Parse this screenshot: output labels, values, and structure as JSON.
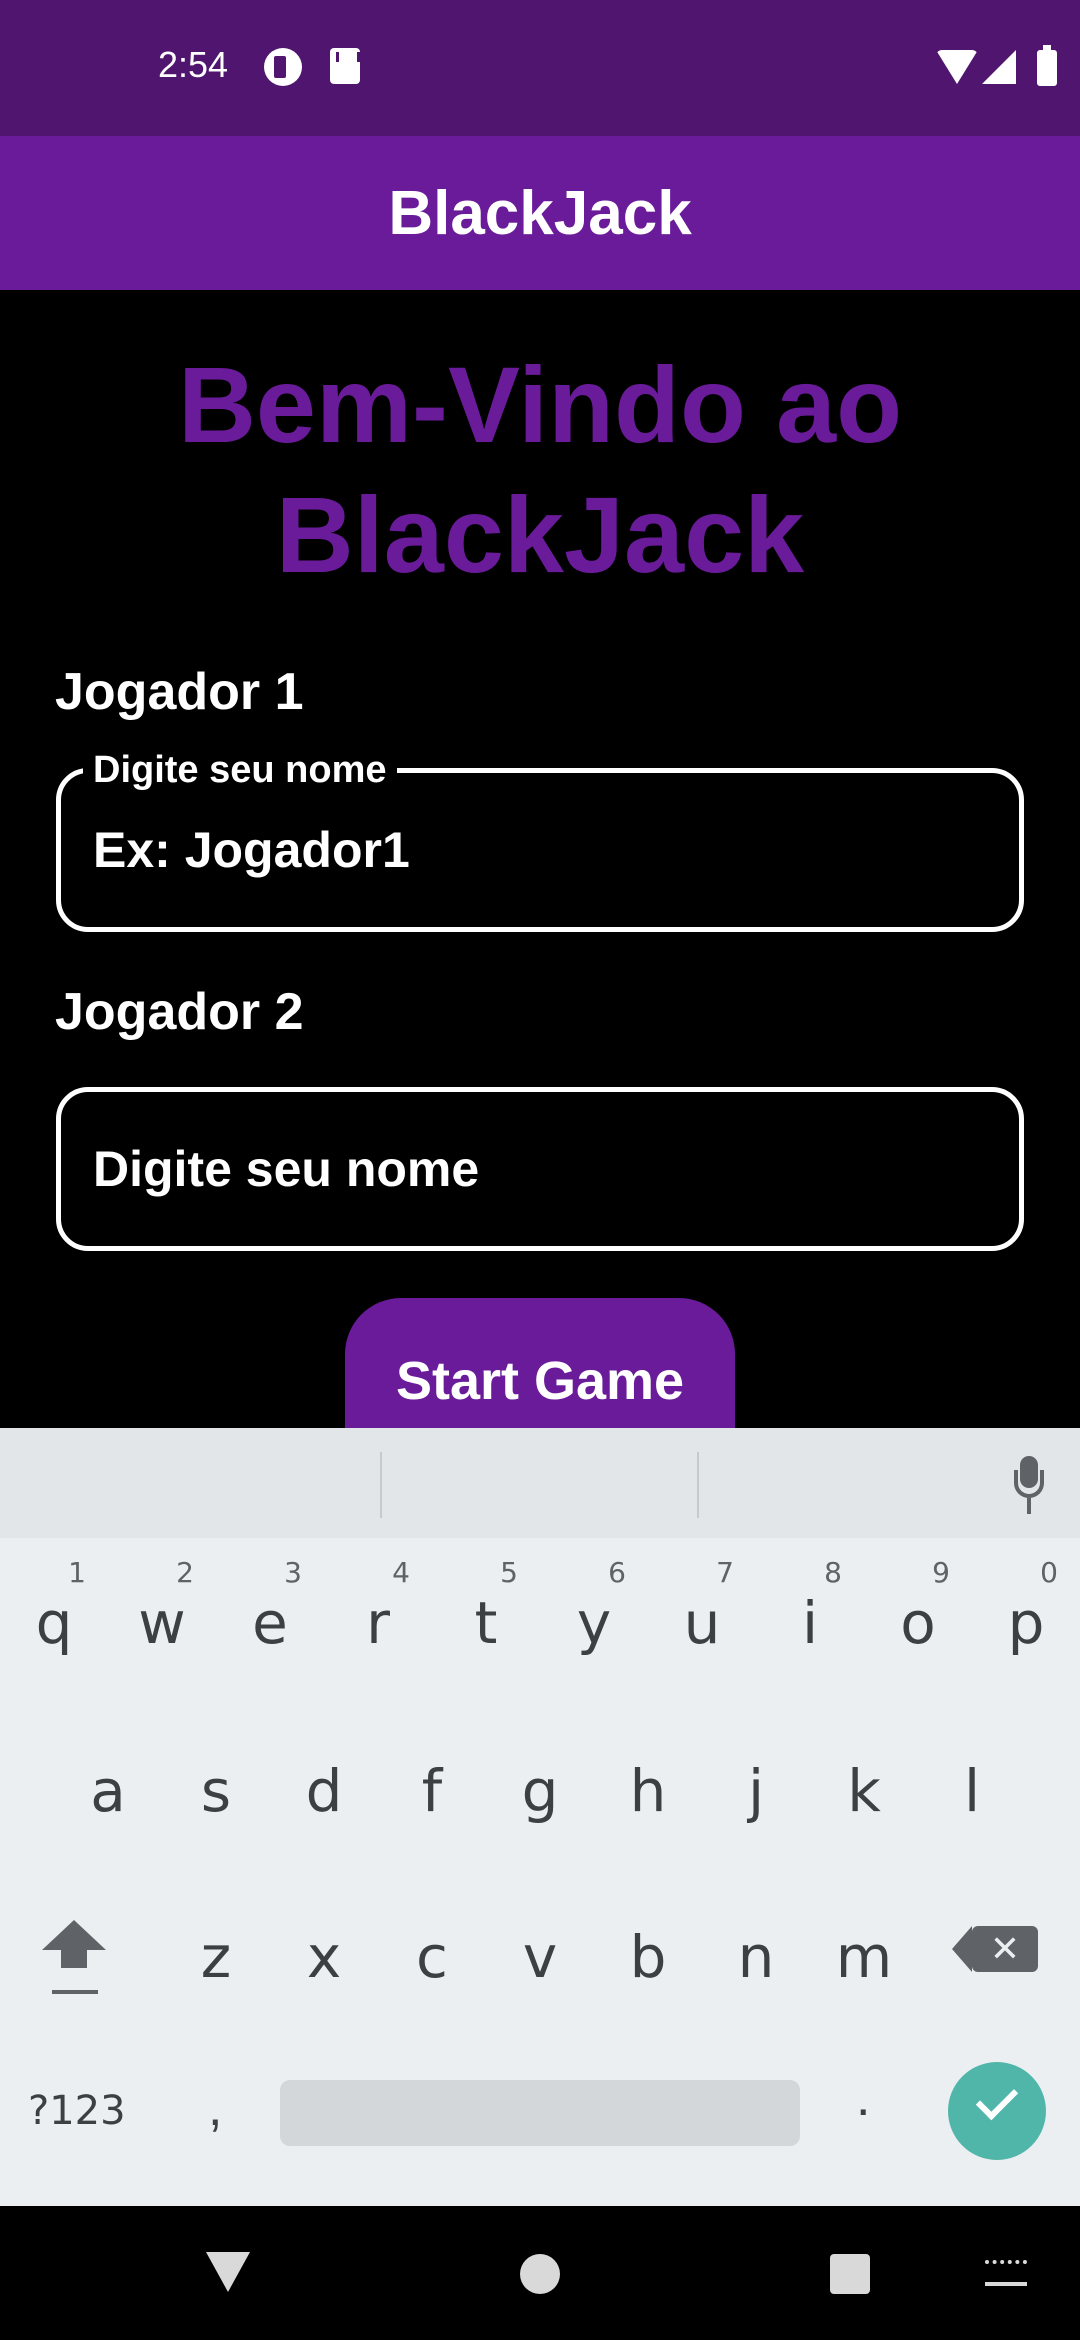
{
  "status_bar": {
    "time": "2:54",
    "icons": [
      "notification-icon",
      "sd-card-icon",
      "wifi-icon",
      "signal-icon",
      "battery-icon"
    ]
  },
  "app_bar": {
    "title": "BlackJack"
  },
  "welcome": {
    "line1": "Bem-Vindo ao",
    "line2": "BlackJack"
  },
  "player1": {
    "label": "Jogador 1",
    "field_label": "Digite seu nome",
    "placeholder": "Ex: Jogador1"
  },
  "player2": {
    "label": "Jogador 2",
    "placeholder": "Digite seu nome"
  },
  "start_button": {
    "label": "Start Game"
  },
  "keyboard": {
    "row1": [
      {
        "key": "q",
        "num": "1"
      },
      {
        "key": "w",
        "num": "2"
      },
      {
        "key": "e",
        "num": "3"
      },
      {
        "key": "r",
        "num": "4"
      },
      {
        "key": "t",
        "num": "5"
      },
      {
        "key": "y",
        "num": "6"
      },
      {
        "key": "u",
        "num": "7"
      },
      {
        "key": "i",
        "num": "8"
      },
      {
        "key": "o",
        "num": "9"
      },
      {
        "key": "p",
        "num": "0"
      }
    ],
    "row2": [
      "a",
      "s",
      "d",
      "f",
      "g",
      "h",
      "j",
      "k",
      "l"
    ],
    "row3": [
      "z",
      "x",
      "c",
      "v",
      "b",
      "n",
      "m"
    ],
    "symbols_label": "?123",
    "comma": ",",
    "period": "."
  },
  "colors": {
    "status_bar": "#4f156f",
    "app_bar": "#6a1b9a",
    "accent": "#6a1b9a",
    "enter_key": "#4fb6a9",
    "keyboard_bg": "#eceff1"
  }
}
